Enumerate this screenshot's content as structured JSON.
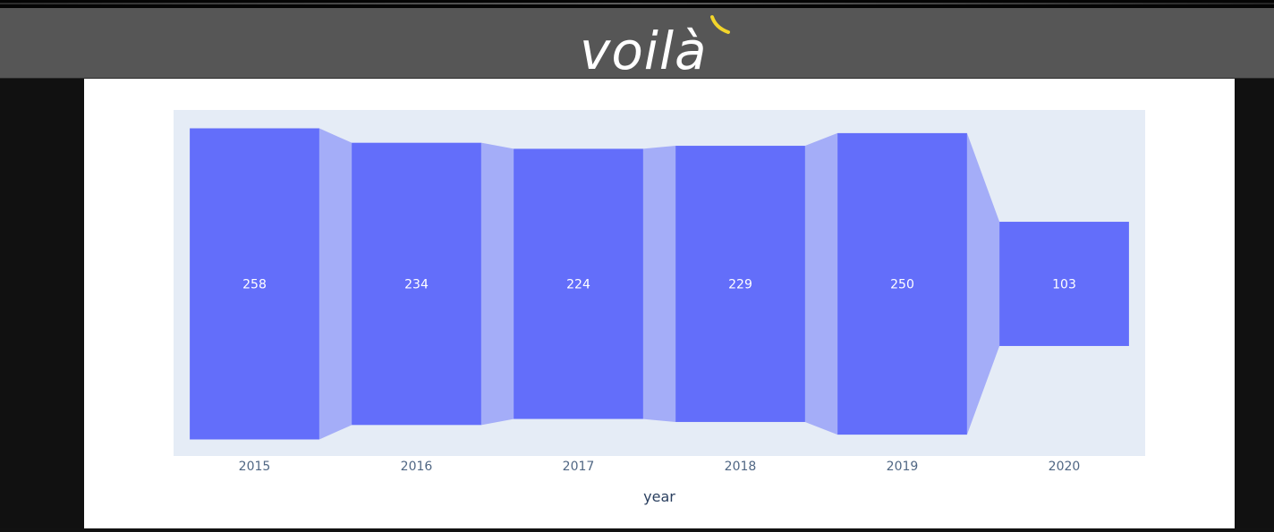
{
  "app": {
    "logo_text": "voilà",
    "logo_accent_color": "#f2d52b"
  },
  "chart_data": {
    "type": "bar",
    "categories": [
      "2015",
      "2016",
      "2017",
      "2018",
      "2019",
      "2020"
    ],
    "values": [
      258,
      234,
      224,
      229,
      250,
      103
    ],
    "xlabel": "year",
    "ylabel": "",
    "title": "",
    "ylim": [
      0,
      258
    ],
    "grid": false,
    "legend": "none",
    "bar_color": "#636efa",
    "connector_color": "#636efa",
    "plot_bg": "#e5ecf6"
  }
}
